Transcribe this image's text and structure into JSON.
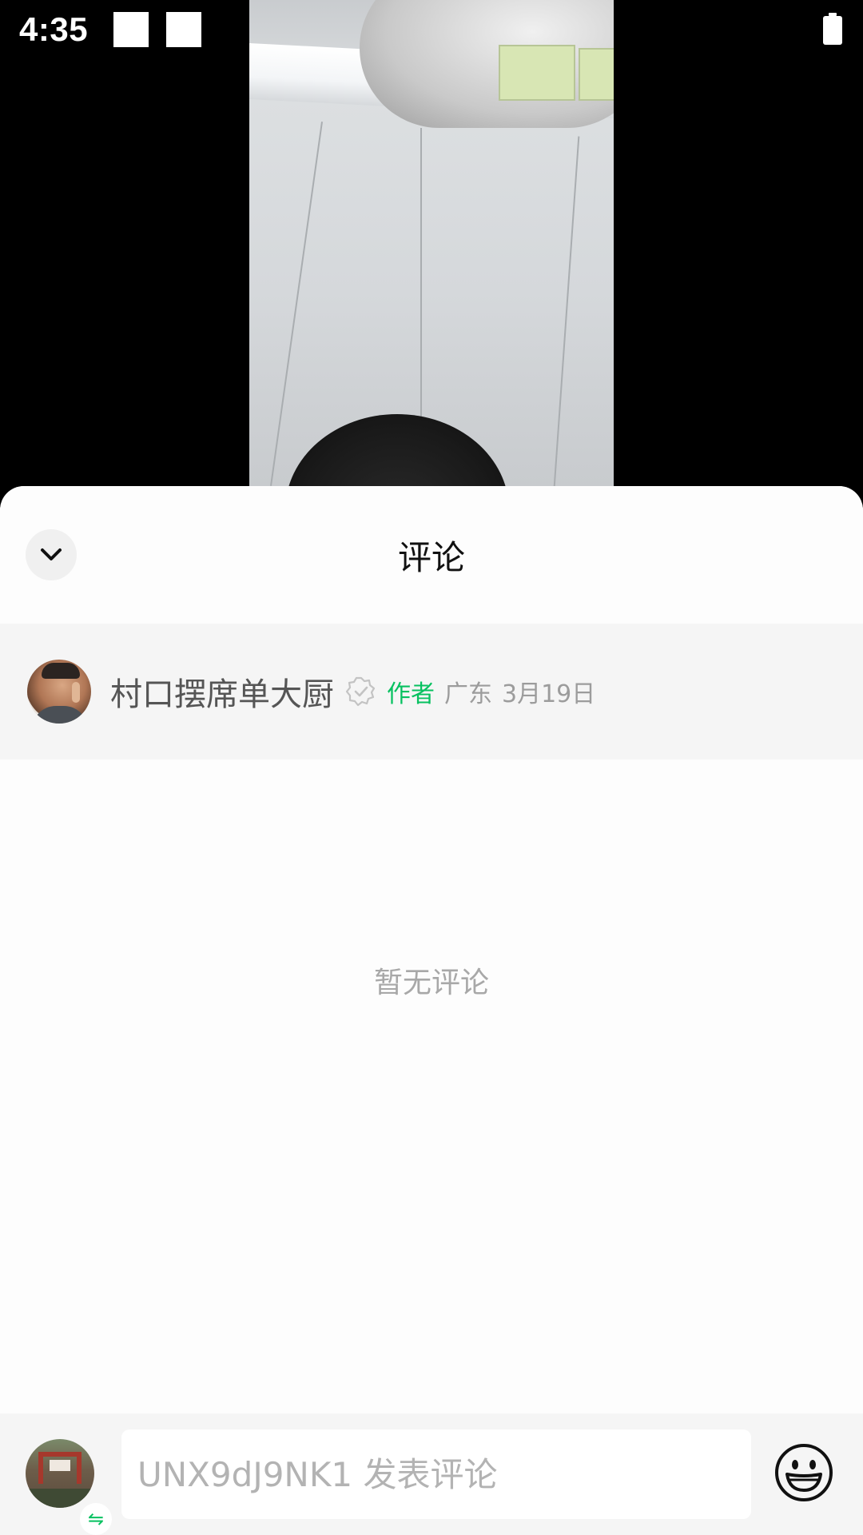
{
  "status_bar": {
    "time": "4:35"
  },
  "comments_sheet": {
    "title": "评论",
    "author": {
      "name": "村口摆席单大厨",
      "tag": "作者",
      "location": "广东",
      "date": "3月19日"
    },
    "empty_text": "暂无评论"
  },
  "input_bar": {
    "placeholder": "UNX9dJ9NK1 发表评论",
    "switch_symbol": "⇋"
  },
  "colors": {
    "accent": "#07c160",
    "sheet_bg": "#fdfdfd",
    "author_row_bg": "#f5f5f5",
    "muted_text": "#9c9c9c"
  }
}
